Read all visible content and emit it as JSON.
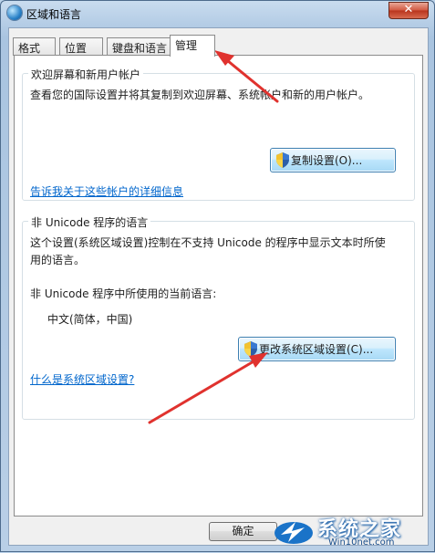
{
  "window": {
    "title": "区域和语言",
    "close": "✕"
  },
  "tabs": [
    {
      "label": "格式"
    },
    {
      "label": "位置"
    },
    {
      "label": "键盘和语言"
    },
    {
      "label": "管理"
    }
  ],
  "welcome_group": {
    "title": "欢迎屏幕和新用户帐户",
    "description": "查看您的国际设置并将其复制到欢迎屏幕、系统帐户和新的用户帐户。",
    "copy_button": "复制设置(O)...",
    "link": "告诉我关于这些帐户的详细信息"
  },
  "unicode_group": {
    "title": "非 Unicode 程序的语言",
    "description_line1": "这个设置(系统区域设置)控制在不支持 Unicode 的程序中显示文本时所使",
    "description_line2": "用的语言。",
    "current_label": "非 Unicode 程序中所使用的当前语言:",
    "current_value": "中文(简体，中国)",
    "change_button": "更改系统区域设置(C)...",
    "link": "什么是系统区域设置?"
  },
  "footer": {
    "ok_button": "确定"
  },
  "watermark": {
    "text": "系统之家",
    "sub": "Win10net.com"
  },
  "colors": {
    "link": "#0066cc",
    "arrow": "#e0322e",
    "accent": "#3c7fb1"
  }
}
